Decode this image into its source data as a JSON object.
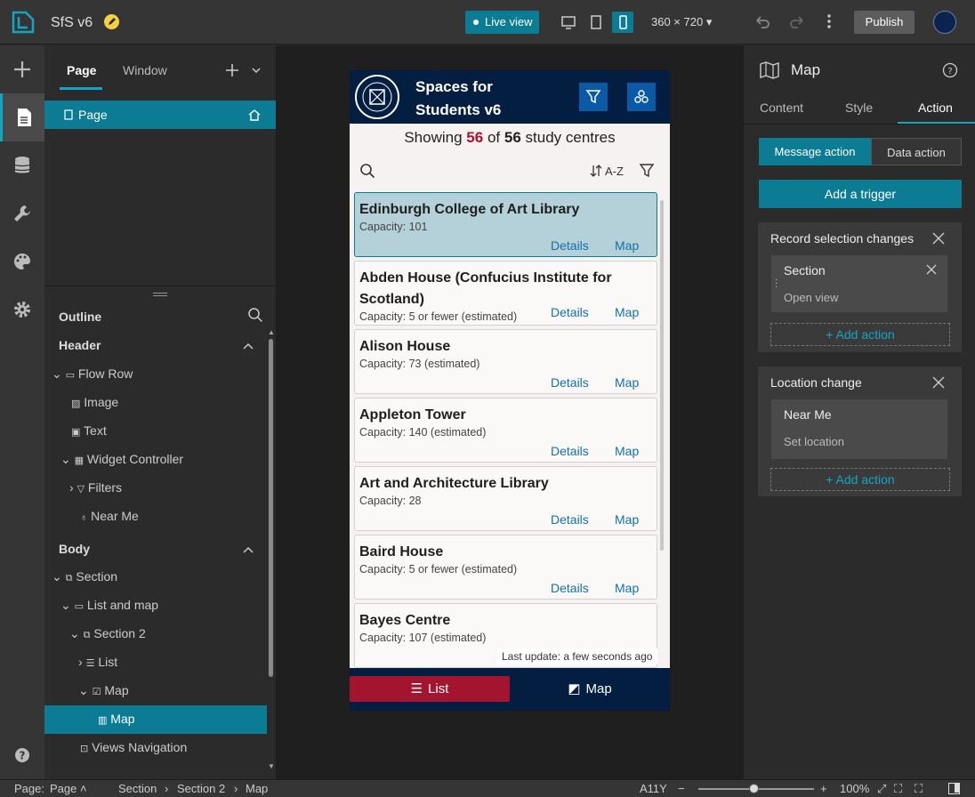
{
  "app": {
    "title": "SfS v6",
    "accent": "#0b7c94"
  },
  "topbar": {
    "live_view": "Live view",
    "device_size": "360 × 720",
    "publish": "Publish",
    "icons": [
      "logo-icon",
      "edit-icon",
      "desktop-icon",
      "tablet-icon",
      "phone-icon",
      "undo-icon",
      "redo-icon",
      "more-icon",
      "avatar"
    ]
  },
  "left_panel": {
    "tabs": [
      "Page",
      "Window"
    ],
    "page_item": "Page",
    "outline_title": "Outline",
    "header_section": "Header",
    "body_section": "Body",
    "tree": {
      "flow_row": "Flow Row",
      "image": "Image",
      "text": "Text",
      "widget_controller": "Widget Controller",
      "filters": "Filters",
      "near_me": "Near Me",
      "section": "Section",
      "list_and_map": "List and map",
      "section2": "Section 2",
      "list": "List",
      "map": "Map",
      "map_child": "Map",
      "views_navigation": "Views Navigation"
    }
  },
  "phone": {
    "title": "Spaces for Students v6",
    "showing_prefix": "Showing",
    "shown": "56",
    "of": "of",
    "total": "56",
    "showing_suffix": "study centres",
    "sort_label": "A-Z",
    "last_update": "Last update: a few seconds ago",
    "nav_list": "List",
    "nav_map": "Map",
    "details": "Details",
    "map_link": "Map",
    "colors": {
      "header": "#041e42",
      "accent_red": "#a3142e",
      "button_blue": "#0b5aa8"
    },
    "items": [
      {
        "name": "Edinburgh College of Art Library",
        "capacity": "Capacity: 101"
      },
      {
        "name": "Abden House (Confucius Institute for Scotland)",
        "capacity": "Capacity: 5 or fewer (estimated)"
      },
      {
        "name": "Alison House",
        "capacity": "Capacity: 73 (estimated)"
      },
      {
        "name": "Appleton Tower",
        "capacity": "Capacity: 140 (estimated)"
      },
      {
        "name": "Art and Architecture Library",
        "capacity": "Capacity: 28"
      },
      {
        "name": "Baird House",
        "capacity": "Capacity: 5 or fewer (estimated)"
      },
      {
        "name": "Bayes Centre",
        "capacity": "Capacity: 107 (estimated)"
      }
    ]
  },
  "right_panel": {
    "title": "Map",
    "tabs": [
      "Content",
      "Style",
      "Action"
    ],
    "seg": [
      "Message action",
      "Data action"
    ],
    "add_trigger": "Add a trigger",
    "trigger1": {
      "title": "Record selection changes",
      "target": "Section",
      "action": "Open view",
      "add": "+ Add action"
    },
    "trigger2": {
      "title": "Location change",
      "target": "Near Me",
      "action": "Set location",
      "add": "+ Add action"
    }
  },
  "statusbar": {
    "page_label": "Page:",
    "page_value": "Page",
    "crumbs": [
      "Section",
      "Section 2",
      "Map"
    ],
    "a11y": "A11Y",
    "zoom": "100%"
  }
}
